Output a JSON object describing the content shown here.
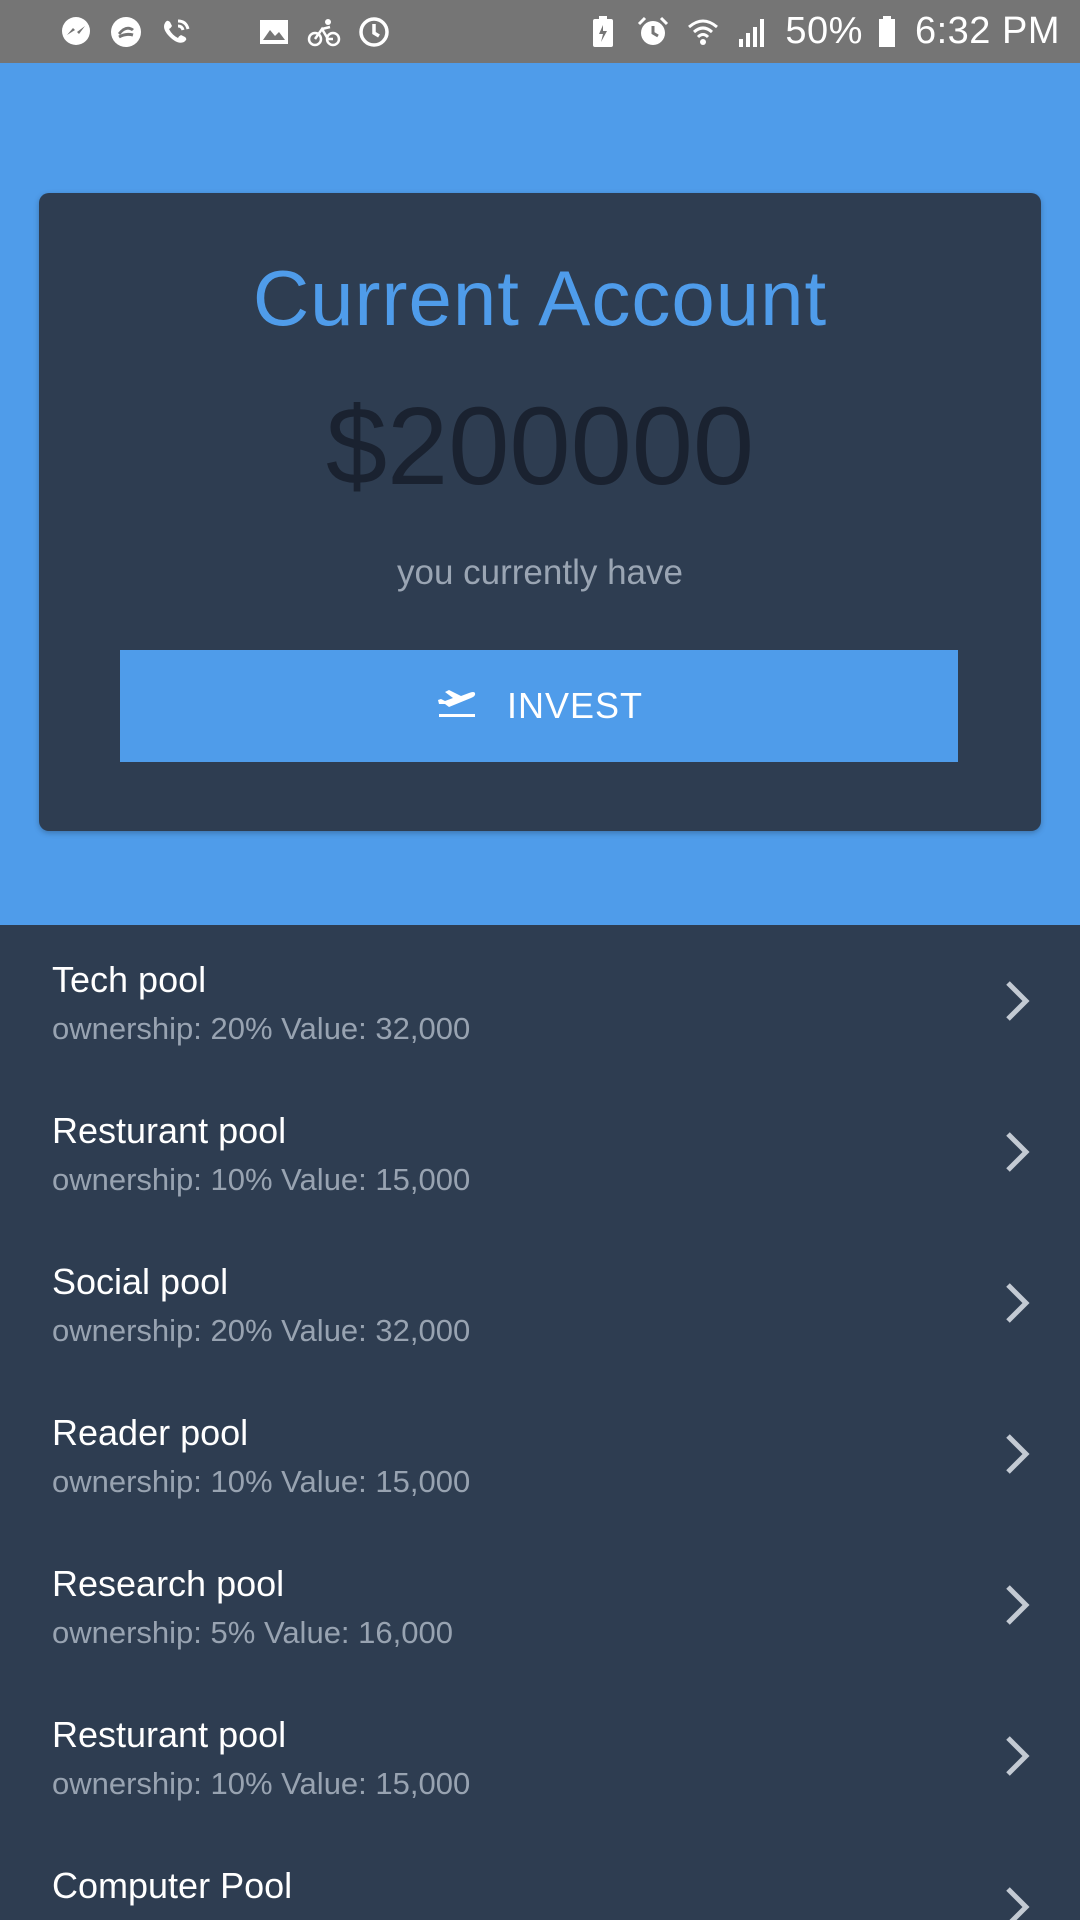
{
  "status_bar": {
    "battery_percent": "50%",
    "time": "6:32 PM"
  },
  "card": {
    "title": "Current Account",
    "amount": "$200000",
    "subtitle": "you currently have",
    "invest_label": "INVEST"
  },
  "pools": [
    {
      "name": "Tech pool",
      "details": "ownership: 20% Value: 32,000"
    },
    {
      "name": "Resturant pool",
      "details": "ownership: 10% Value: 15,000"
    },
    {
      "name": "Social pool",
      "details": "ownership: 20% Value: 32,000"
    },
    {
      "name": "Reader pool",
      "details": "ownership: 10% Value: 15,000"
    },
    {
      "name": "Research pool",
      "details": "ownership: 5% Value: 16,000"
    },
    {
      "name": "Resturant pool",
      "details": "ownership: 10% Value: 15,000"
    },
    {
      "name": "Computer Pool",
      "details": ""
    }
  ],
  "colors": {
    "accent": "#4f9cea",
    "dark": "#2e3d51",
    "status_bar": "#757575"
  },
  "icons": {
    "invest": "airplane-takeoff-icon",
    "row": "chevron-right-icon"
  }
}
